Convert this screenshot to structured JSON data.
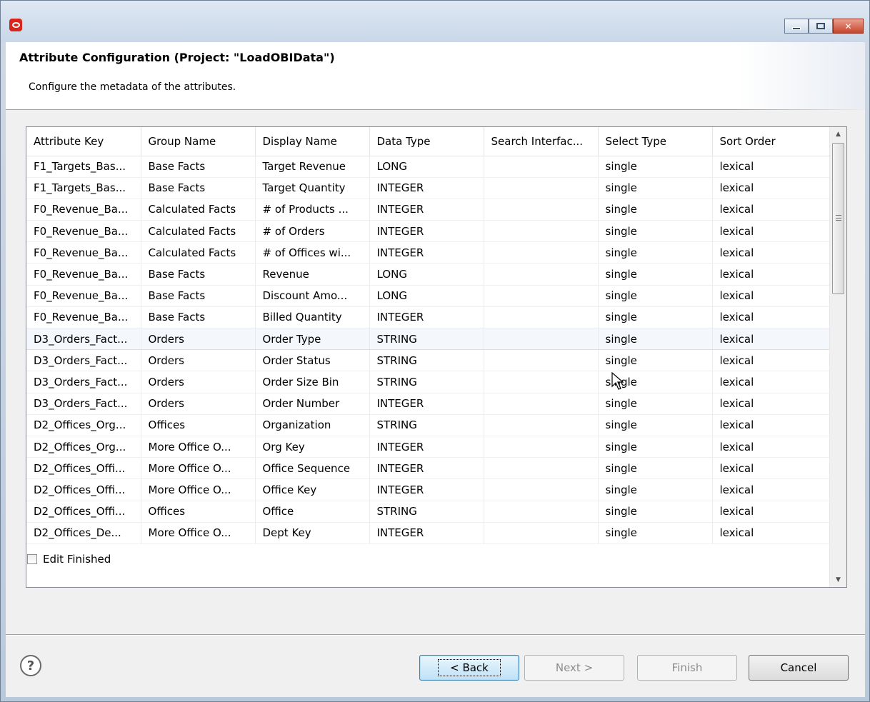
{
  "window": {
    "title": ""
  },
  "header": {
    "title": "Attribute Configuration (Project: \"LoadOBIData\")",
    "description": "Configure the metadata of the attributes."
  },
  "table": {
    "columns": [
      "Attribute Key",
      "Group Name",
      "Display Name",
      "Data Type",
      "Search Interfac...",
      "Select Type",
      "Sort Order"
    ],
    "rows": [
      [
        "F1_Targets_Bas...",
        "Base Facts",
        "Target Revenue",
        "LONG",
        "",
        "single",
        "lexical"
      ],
      [
        "F1_Targets_Bas...",
        "Base Facts",
        "Target Quantity",
        "INTEGER",
        "",
        "single",
        "lexical"
      ],
      [
        "F0_Revenue_Ba...",
        "Calculated Facts",
        "# of Products ...",
        "INTEGER",
        "",
        "single",
        "lexical"
      ],
      [
        "F0_Revenue_Ba...",
        "Calculated Facts",
        "# of Orders",
        "INTEGER",
        "",
        "single",
        "lexical"
      ],
      [
        "F0_Revenue_Ba...",
        "Calculated Facts",
        "# of Offices wi...",
        "INTEGER",
        "",
        "single",
        "lexical"
      ],
      [
        "F0_Revenue_Ba...",
        "Base Facts",
        "Revenue",
        "LONG",
        "",
        "single",
        "lexical"
      ],
      [
        "F0_Revenue_Ba...",
        "Base Facts",
        "Discount Amo...",
        "LONG",
        "",
        "single",
        "lexical"
      ],
      [
        "F0_Revenue_Ba...",
        "Base Facts",
        "Billed Quantity",
        "INTEGER",
        "",
        "single",
        "lexical"
      ],
      [
        "D3_Orders_Fact...",
        "Orders",
        "Order Type",
        "STRING",
        "",
        "single",
        "lexical"
      ],
      [
        "D3_Orders_Fact...",
        "Orders",
        "Order Status",
        "STRING",
        "",
        "single",
        "lexical"
      ],
      [
        "D3_Orders_Fact...",
        "Orders",
        "Order Size Bin",
        "STRING",
        "",
        "single",
        "lexical"
      ],
      [
        "D3_Orders_Fact...",
        "Orders",
        "Order Number",
        "INTEGER",
        "",
        "single",
        "lexical"
      ],
      [
        "D2_Offices_Org...",
        "Offices",
        "Organization",
        "STRING",
        "",
        "single",
        "lexical"
      ],
      [
        "D2_Offices_Org...",
        "More Office O...",
        "Org Key",
        "INTEGER",
        "",
        "single",
        "lexical"
      ],
      [
        "D2_Offices_Offi...",
        "More Office O...",
        "Office Sequence",
        "INTEGER",
        "",
        "single",
        "lexical"
      ],
      [
        "D2_Offices_Offi...",
        "More Office O...",
        "Office Key",
        "INTEGER",
        "",
        "single",
        "lexical"
      ],
      [
        "D2_Offices_Offi...",
        "Offices",
        "Office",
        "STRING",
        "",
        "single",
        "lexical"
      ],
      [
        "D2_Offices_De...",
        "More Office O...",
        "Dept Key",
        "INTEGER",
        "",
        "single",
        "lexical"
      ]
    ],
    "hover_row": 8
  },
  "checkbox": {
    "label": "Edit Finished",
    "checked": false
  },
  "buttons": {
    "back": "< Back",
    "next": "Next >",
    "finish": "Finish",
    "cancel": "Cancel"
  },
  "icons": {
    "app": "oracle-icon",
    "help": "help-icon",
    "minimize": "minimize-icon",
    "maximize": "maximize-icon",
    "close": "close-icon"
  },
  "colors": {
    "accent_close": "#c8442b",
    "brand_icon": "#d9261c",
    "default_button": "#3c7fb1"
  }
}
